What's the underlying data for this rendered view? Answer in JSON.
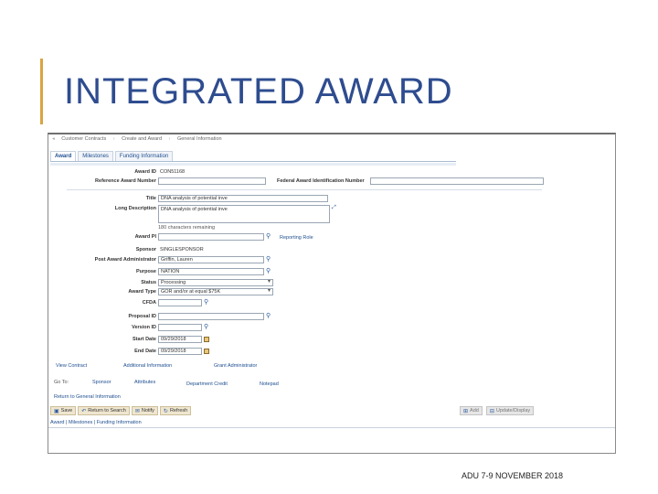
{
  "slide": {
    "title": "INTEGRATED AWARD",
    "footer": "ADU 7-9 NOVEMBER 2018",
    "accent_color": "#d9a441",
    "title_color": "#2e4c8f"
  },
  "breadcrumb": [
    "Customer Contracts",
    "Create and Award",
    "General Information"
  ],
  "tabs": [
    "Award",
    "Milestones",
    "Funding Information"
  ],
  "form": {
    "award_id_label": "Award ID",
    "award_id_value": "CON51168",
    "ref_award_label": "Reference Award Number",
    "federal_id_label": "Federal Award Identification Number",
    "title_label": "Title",
    "title_value": "DNA analysis of potential inve",
    "long_desc_label": "Long Description",
    "long_desc_value": "DNA analysis of potential inve",
    "chars_remaining": "180 characters remaining",
    "award_pi_label": "Award PI",
    "reporting_role": "Reporting Role",
    "sponsor_label": "Sponsor",
    "sponsor_value": "SINGLESPONSOR",
    "post_admin_label": "Post Award Administrator",
    "post_admin_value": "Griffin, Lauren",
    "purpose_label": "Purpose",
    "purpose_value": "NATION",
    "status_label": "Status",
    "status_value": "Processing",
    "award_type_label": "Award Type",
    "award_type_value": "GOR and/or at equal $75K",
    "cfda_label": "CFDA",
    "proposal_id_label": "Proposal ID",
    "version_id_label": "Version ID",
    "start_date_label": "Start Date",
    "start_date_value": "09/29/2018",
    "end_date_label": "End Date",
    "end_date_value": "09/29/2018"
  },
  "links": {
    "view_contract": "View Contract",
    "additional_info": "Additional Information",
    "grant_admin": "Grant Administrator",
    "goto": "Go To:",
    "sponsor": "Sponsor",
    "attributes": "Attributes",
    "department_credit": "Department Credit",
    "notepad": "Notepad",
    "return_general": "Return to General Information"
  },
  "toolbar": {
    "save": "Save",
    "return_search": "Return to Search",
    "notify": "Notify",
    "refresh": "Refresh",
    "add": "Add",
    "update_display": "Update/Display"
  },
  "bottom_tabs": "Award | Milestones | Funding Information"
}
